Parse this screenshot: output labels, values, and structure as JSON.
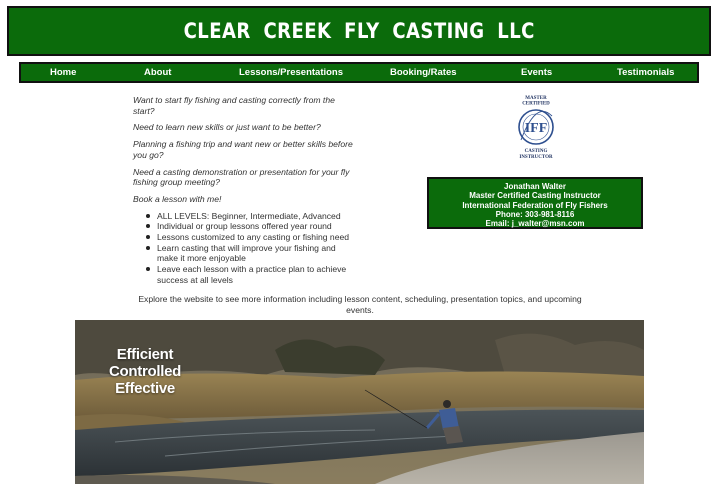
{
  "header": {
    "title": "CLEAR CREEK FLY CASTING LLC"
  },
  "nav": {
    "items": [
      {
        "label": "Home"
      },
      {
        "label": "About"
      },
      {
        "label": "Lessons/Presentations"
      },
      {
        "label": "Booking/Rates"
      },
      {
        "label": "Events"
      },
      {
        "label": "Testimonials"
      }
    ]
  },
  "intro": {
    "questions": [
      "Want to start fly fishing and casting correctly from the start?",
      "Need to learn new skills or just want to be better?",
      "Planning a fishing trip and want new or better skills before you go?",
      "Need a casting demonstration or presentation for your fly fishing group meeting?",
      "Book a lesson with me!"
    ],
    "bullets": [
      "ALL LEVELS: Beginner, Intermediate, Advanced",
      "Individual or group lessons offered year round",
      "Lessons customized to any casting or fishing need",
      "Learn casting that will improve your fishing and make it more enjoyable",
      "Leave each lesson with a practice plan to achieve success at all levels"
    ]
  },
  "badge": {
    "top_line1": "MASTER",
    "top_line2": "CERTIFIED",
    "logo": "IFF",
    "bottom_line1": "CASTING",
    "bottom_line2": "INSTRUCTOR"
  },
  "contact": {
    "name": "Jonathan Walter",
    "title": "Master Certified Casting Instructor",
    "org": "International Federation of Fly Fishers",
    "phone": "Phone: 303-981-8116",
    "email": "Email: j_walter@msn.com"
  },
  "explore_text": "Explore the website to see more information including lesson content, scheduling, presentation topics, and upcoming events.",
  "hero": {
    "tagline": [
      "Efficient",
      "Controlled",
      "Effective"
    ]
  },
  "colors": {
    "brand_green": "#0b6b0b",
    "text": "#333333",
    "badge_blue": "#2e4f8f"
  }
}
